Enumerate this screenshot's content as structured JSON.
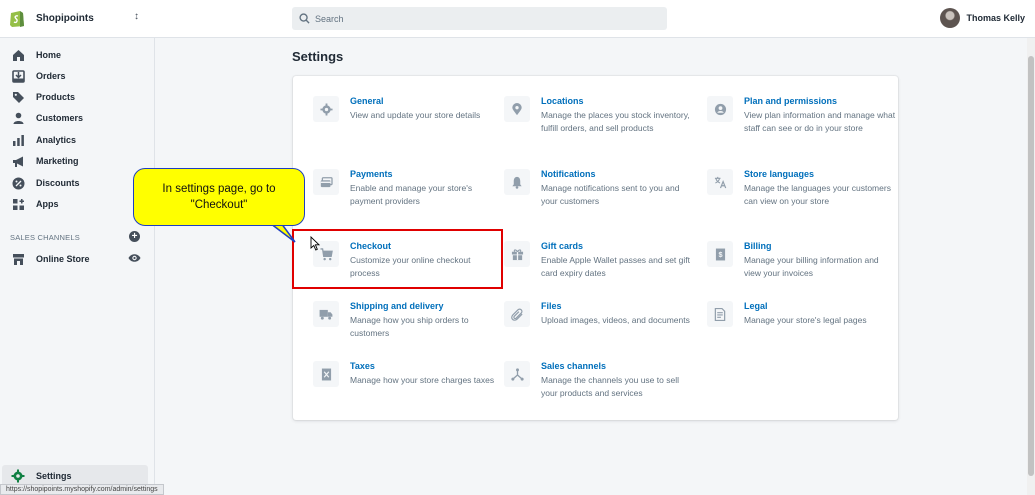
{
  "store": {
    "name": "Shopipoints",
    "switch_icon": "updown-caret-icon"
  },
  "search": {
    "placeholder": "Search"
  },
  "user": {
    "name": "Thomas Kelly"
  },
  "sidebar": {
    "items": [
      {
        "label": "Home",
        "icon": "home-icon"
      },
      {
        "label": "Orders",
        "icon": "orders-icon"
      },
      {
        "label": "Products",
        "icon": "tag-icon"
      },
      {
        "label": "Customers",
        "icon": "person-icon"
      },
      {
        "label": "Analytics",
        "icon": "bar-chart-icon"
      },
      {
        "label": "Marketing",
        "icon": "megaphone-icon"
      },
      {
        "label": "Discounts",
        "icon": "discount-icon"
      },
      {
        "label": "Apps",
        "icon": "apps-icon"
      }
    ],
    "channels_header": "SALES CHANNELS",
    "online_store": "Online Store",
    "settings": "Settings"
  },
  "page": {
    "title": "Settings"
  },
  "settings": [
    {
      "title": "General",
      "desc": "View and update your store details",
      "icon": "gear-icon"
    },
    {
      "title": "Locations",
      "desc": "Manage the places you stock inventory, fulfill orders, and sell products",
      "icon": "location-pin-icon"
    },
    {
      "title": "Plan and permissions",
      "desc": "View plan information and manage what staff can see or do in your store",
      "icon": "account-icon"
    },
    {
      "title": "Payments",
      "desc": "Enable and manage your store's payment providers",
      "icon": "card-icon"
    },
    {
      "title": "Notifications",
      "desc": "Manage notifications sent to you and your customers",
      "icon": "bell-icon"
    },
    {
      "title": "Store languages",
      "desc": "Manage the languages your customers can view on your store",
      "icon": "translate-icon"
    },
    {
      "title": "Checkout",
      "desc": "Customize your online checkout process",
      "icon": "cart-icon"
    },
    {
      "title": "Gift cards",
      "desc": "Enable Apple Wallet passes and set gift card expiry dates",
      "icon": "gift-icon"
    },
    {
      "title": "Billing",
      "desc": "Manage your billing information and view your invoices",
      "icon": "receipt-icon"
    },
    {
      "title": "Shipping and delivery",
      "desc": "Manage how you ship orders to customers",
      "icon": "truck-icon"
    },
    {
      "title": "Files",
      "desc": "Upload images, videos, and documents",
      "icon": "paperclip-icon"
    },
    {
      "title": "Legal",
      "desc": "Manage your store's legal pages",
      "icon": "document-icon"
    },
    {
      "title": "Taxes",
      "desc": "Manage how your store charges taxes",
      "icon": "tax-icon"
    },
    {
      "title": "Sales channels",
      "desc": "Manage the channels you use to sell your products and services",
      "icon": "channels-icon"
    }
  ],
  "callout": {
    "text": "In settings page, go to \"Checkout\""
  },
  "status_url": "https://shopipoints.myshopify.com/admin/settings",
  "colors": {
    "brand": "#95bf47",
    "link": "#006fbb",
    "callout_bg": "#ffff00",
    "highlight": "#e00000"
  }
}
